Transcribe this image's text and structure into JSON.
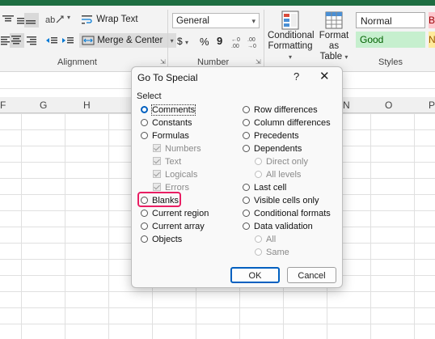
{
  "ribbon": {
    "wrap_text": "Wrap Text",
    "merge_center": "Merge & Center",
    "alignment_label": "Alignment",
    "number_format": "General",
    "number_label": "Number",
    "currency": "$",
    "percent": "%",
    "comma": "9",
    "inc_decimal": "←.0 .00",
    "dec_decimal": ".00 →.0",
    "conditional_formatting": [
      "Conditional",
      "Formatting"
    ],
    "format_as_table": [
      "Format as",
      "Table"
    ],
    "styles_label": "Styles",
    "style_normal": "Normal",
    "style_good": "Good",
    "style_bad": "B",
    "style_neutral": "N"
  },
  "columns": [
    "F",
    "G",
    "H",
    "N",
    "O",
    "P"
  ],
  "dialog": {
    "title": "Go To Special",
    "help": "?",
    "close": "✕",
    "section": "Select",
    "left_options": [
      {
        "label": "Comments",
        "type": "radio",
        "selected": true
      },
      {
        "label": "Constants",
        "type": "radio"
      },
      {
        "label": "Formulas",
        "type": "radio"
      },
      {
        "label": "Numbers",
        "type": "check",
        "disabled": true
      },
      {
        "label": "Text",
        "type": "check",
        "disabled": true
      },
      {
        "label": "Logicals",
        "type": "check",
        "disabled": true
      },
      {
        "label": "Errors",
        "type": "check",
        "disabled": true
      },
      {
        "label": "Blanks",
        "type": "radio",
        "highlighted": true
      },
      {
        "label": "Current region",
        "type": "radio"
      },
      {
        "label": "Current array",
        "type": "radio"
      },
      {
        "label": "Objects",
        "type": "radio"
      }
    ],
    "right_options": [
      {
        "label": "Row differences",
        "type": "radio"
      },
      {
        "label": "Column differences",
        "type": "radio"
      },
      {
        "label": "Precedents",
        "type": "radio"
      },
      {
        "label": "Dependents",
        "type": "radio"
      },
      {
        "label": "Direct only",
        "type": "radio",
        "disabled": true
      },
      {
        "label": "All levels",
        "type": "radio",
        "disabled": true
      },
      {
        "label": "Last cell",
        "type": "radio"
      },
      {
        "label": "Visible cells only",
        "type": "radio"
      },
      {
        "label": "Conditional formats",
        "type": "radio"
      },
      {
        "label": "Data validation",
        "type": "radio"
      },
      {
        "label": "All",
        "type": "radio",
        "disabled": true
      },
      {
        "label": "Same",
        "type": "radio",
        "disabled": true
      }
    ],
    "ok": "OK",
    "cancel": "Cancel"
  },
  "colors": {
    "highlight": "#e91e63",
    "accent": "#0060c0",
    "excel_green": "#1e6e42"
  }
}
